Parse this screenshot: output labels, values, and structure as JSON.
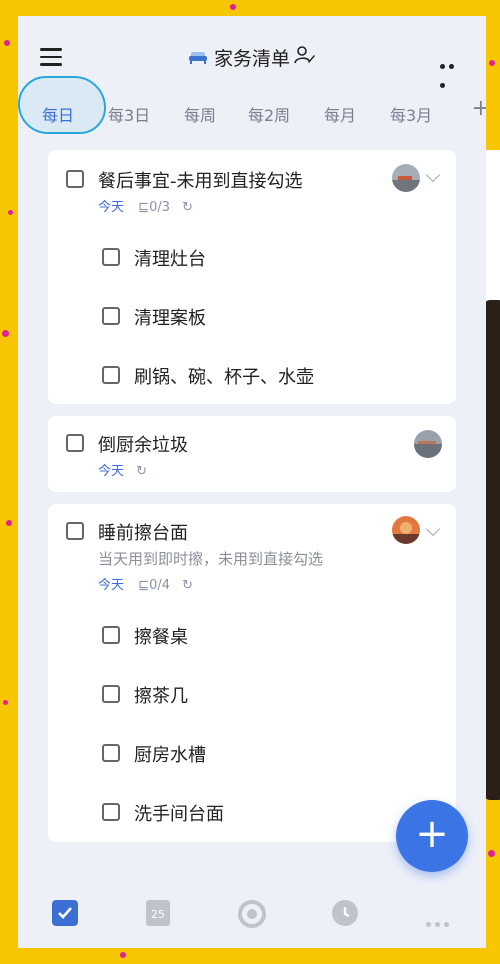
{
  "header": {
    "title": "家务清单",
    "menu_icon": "menu-icon",
    "more_icon": "more-icon"
  },
  "tabs": [
    {
      "label": "每日",
      "active": true
    },
    {
      "label": "每3日",
      "active": false
    },
    {
      "label": "每周",
      "active": false
    },
    {
      "label": "每2周",
      "active": false
    },
    {
      "label": "每月",
      "active": false
    },
    {
      "label": "每3月",
      "active": false
    }
  ],
  "tab_add": "+",
  "tasks": [
    {
      "title": "餐后事宜-未用到直接勾选",
      "date": "今天",
      "subtask_count": "0/3",
      "subtasks": [
        "清理灶台",
        "清理案板",
        "刷锅、碗、杯子、水壶"
      ]
    },
    {
      "title": "倒厨余垃圾",
      "date": "今天"
    },
    {
      "title": "睡前擦台面",
      "note": "当天用到即时擦，未用到直接勾选",
      "date": "今天",
      "subtask_count": "0/4",
      "subtasks": [
        "擦餐桌",
        "擦茶几",
        "厨房水槽",
        "洗手间台面"
      ]
    }
  ],
  "fab_label": "+",
  "bottom_nav": {
    "calendar_day": "25"
  },
  "colors": {
    "accent": "#3b6fd4",
    "background": "#eef0f8",
    "frame": "#f7c600"
  }
}
